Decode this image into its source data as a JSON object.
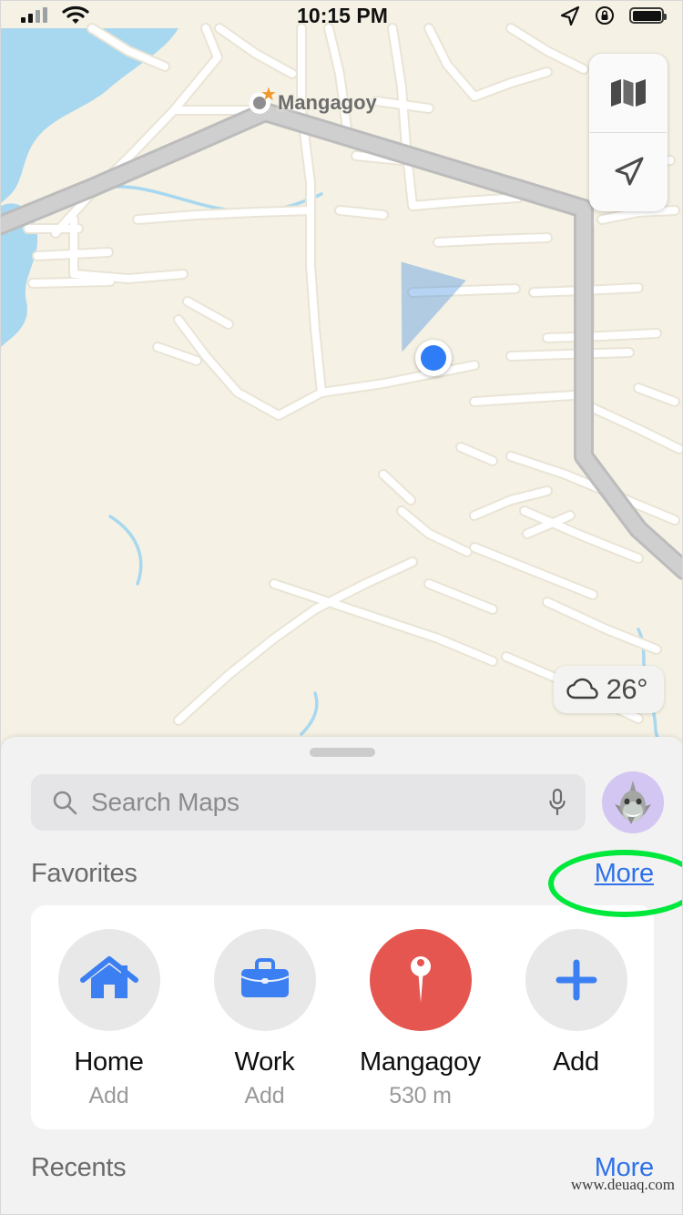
{
  "status_bar": {
    "time": "10:15 PM",
    "signal_icon": "cellular-bars-icon",
    "wifi_icon": "wifi-icon",
    "location_icon": "location-arrow-icon",
    "rotation_lock_icon": "rotation-lock-icon",
    "battery_icon": "battery-full-icon"
  },
  "map": {
    "poi_label": "Mangagoy",
    "poi_marker_icon": "favorite-star-marker-icon",
    "user_location_icon": "user-location-dot-icon",
    "land_color": "#f5f1e4",
    "water_color": "#a8d8f0",
    "road_color": "#ffffff",
    "highway_color": "#c9c9c9",
    "controls": {
      "layers_icon": "folded-map-icon",
      "tracking_icon": "location-arrow-outline-icon"
    },
    "weather": {
      "icon": "cloud-icon",
      "temperature": "26°"
    }
  },
  "sheet": {
    "grabber_icon": "sheet-grabber-icon",
    "search": {
      "placeholder": "Search Maps",
      "value": "",
      "search_icon": "search-icon",
      "mic_icon": "microphone-icon"
    },
    "avatar": {
      "icon": "shark-memoji-avatar-icon",
      "background_color": "#d3c6f2"
    },
    "favorites": {
      "title": "Favorites",
      "more_label": "More",
      "more_color": "#2f72e8",
      "items": [
        {
          "name": "Home",
          "subtitle": "Add",
          "icon": "house-icon",
          "circle_color": "#e8e8e8",
          "icon_color": "#3b7ff2"
        },
        {
          "name": "Work",
          "subtitle": "Add",
          "icon": "briefcase-icon",
          "circle_color": "#e8e8e8",
          "icon_color": "#3b7ff2"
        },
        {
          "name": "Mangagoy",
          "subtitle": "530 m",
          "icon": "map-pin-icon",
          "circle_color": "#e4564f",
          "icon_color": "#ffffff"
        },
        {
          "name": "Add",
          "subtitle": "",
          "icon": "plus-icon",
          "circle_color": "#e8e8e8",
          "icon_color": "#3b7ff2"
        }
      ]
    },
    "recents": {
      "title": "Recents",
      "more_label": "More"
    }
  },
  "annotation": {
    "shape": "ellipse-highlight",
    "color": "#00e83b",
    "target": "More"
  },
  "watermark": {
    "text": "www.deuaq.com"
  }
}
